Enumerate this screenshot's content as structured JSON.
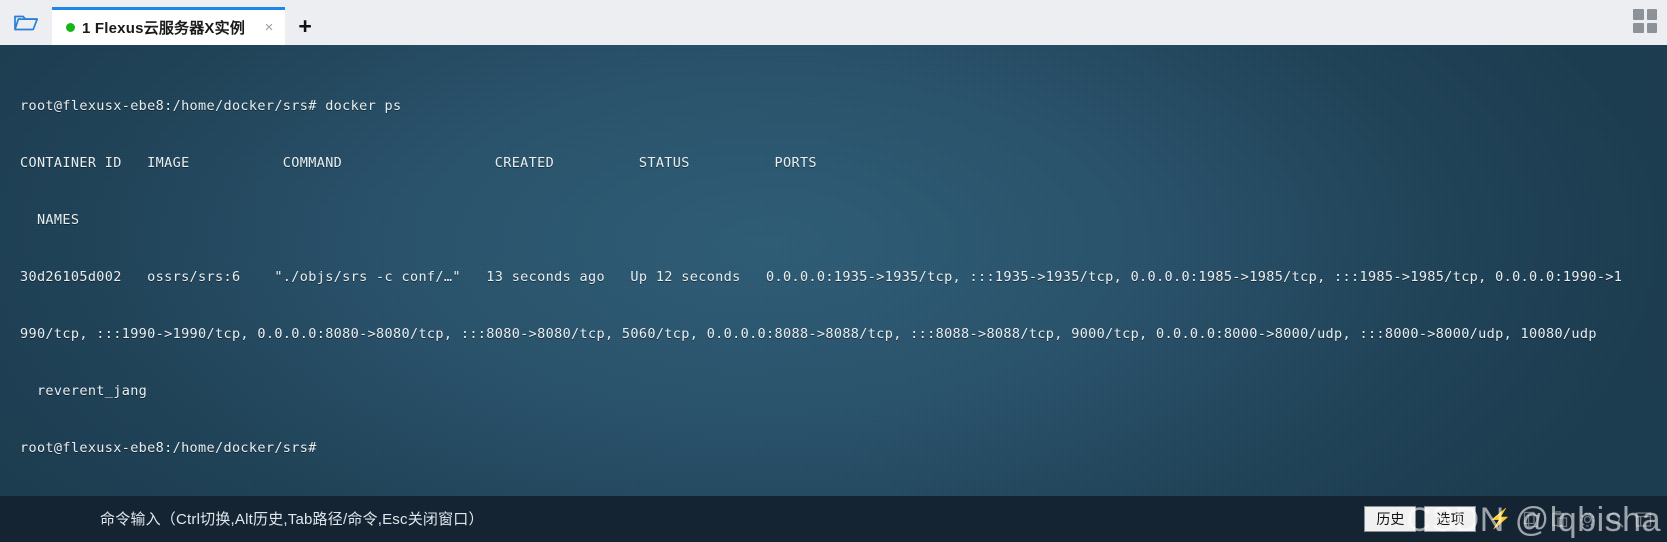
{
  "window": {
    "folder_icon": "open-folder-icon",
    "grid_icon": "grid-menu-icon"
  },
  "tabs": [
    {
      "title": "1 Flexus云服务器X实例",
      "status_dot_color": "#16b616",
      "close_label": "×",
      "active": true
    }
  ],
  "new_tab_label": "+",
  "terminal": {
    "prompt": "root@flexusx-ebe8:/home/docker/srs#",
    "lines": [
      "root@flexusx-ebe8:/home/docker/srs# docker ps",
      "CONTAINER ID   IMAGE           COMMAND                  CREATED          STATUS          PORTS",
      "  NAMES",
      "30d26105d002   ossrs/srs:6    \"./objs/srs -c conf/…\"   13 seconds ago   Up 12 seconds   0.0.0.0:1935->1935/tcp, :::1935->1935/tcp, 0.0.0.0:1985->1985/tcp, :::1985->1985/tcp, 0.0.0.0:1990->1",
      "990/tcp, :::1990->1990/tcp, 0.0.0.0:8080->8080/tcp, :::8080->8080/tcp, 5060/tcp, 0.0.0.0:8088->8088/tcp, :::8088->8088/tcp, 9000/tcp, 0.0.0.0:8000->8000/udp, :::8000->8000/udp, 10080/udp",
      "  reverent_jang",
      "root@flexusx-ebe8:/home/docker/srs#"
    ],
    "background_color": "#27516a",
    "text_color": "#e9eef1"
  },
  "statusbar": {
    "input_placeholder": "命令输入（Ctrl切换,Alt历史,Tab路径/命令,Esc关闭窗口）",
    "input_value": "",
    "history_label": "历史",
    "options_label": "选项",
    "bolt_icon": "lightning-bolt-icon",
    "bolt_color": "#29d42f",
    "icons": [
      "copy-icon",
      "paste-icon",
      "gear-icon",
      "search-icon",
      "window-icon"
    ],
    "background_color": "#152433"
  },
  "watermark": "CSDN @lqbisha"
}
